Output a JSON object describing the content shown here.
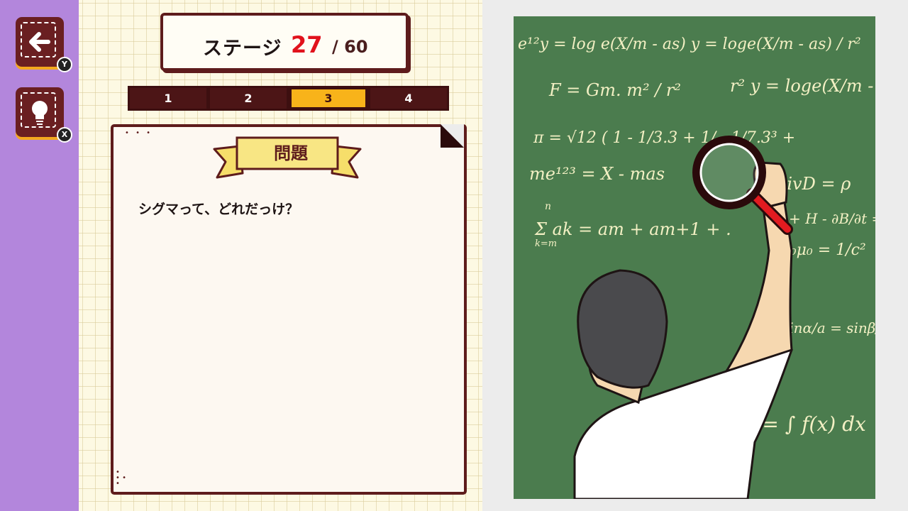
{
  "nav": {
    "back_button": {
      "icon": "arrow-left-icon",
      "key": "Y"
    },
    "hint_button": {
      "icon": "lightbulb-icon",
      "key": "X"
    }
  },
  "header": {
    "stage_label": "ステージ",
    "stage_current": "27",
    "stage_total": "/ 60"
  },
  "tabs": [
    {
      "label": "1",
      "active": false
    },
    {
      "label": "2",
      "active": false
    },
    {
      "label": "3",
      "active": true
    },
    {
      "label": "4",
      "active": false
    }
  ],
  "card": {
    "banner_title": "問題",
    "question": "シグマって、どれだっけ？"
  },
  "blackboard": {
    "formulas": [
      "e¹²y = log e(X/m - as)  y = loge(X/m - as) / r²",
      "F = Gm. m² / r²",
      "r² y = loge(X/m -",
      "π = √12 ( 1 - 1/3.3 + 1/ - 1/7.3³ +",
      "me¹²³ = X - mas",
      "divD = ρ",
      "Σ ak = am + am+1 + .",
      "k=m",
      "n",
      "+ H - ∂B/∂t =",
      "ε₀μ₀ = 1/c²",
      "sinα/a = sinβ/b =",
      "F = ∫ f(x) dx"
    ]
  },
  "colors": {
    "accent_red": "#e1121c",
    "frame_brown": "#5e1c1c",
    "tab_active": "#f8b31a",
    "rail_purple": "#b386dc",
    "board_green": "#4b7c4e",
    "chalk": "#f3f0c4"
  }
}
